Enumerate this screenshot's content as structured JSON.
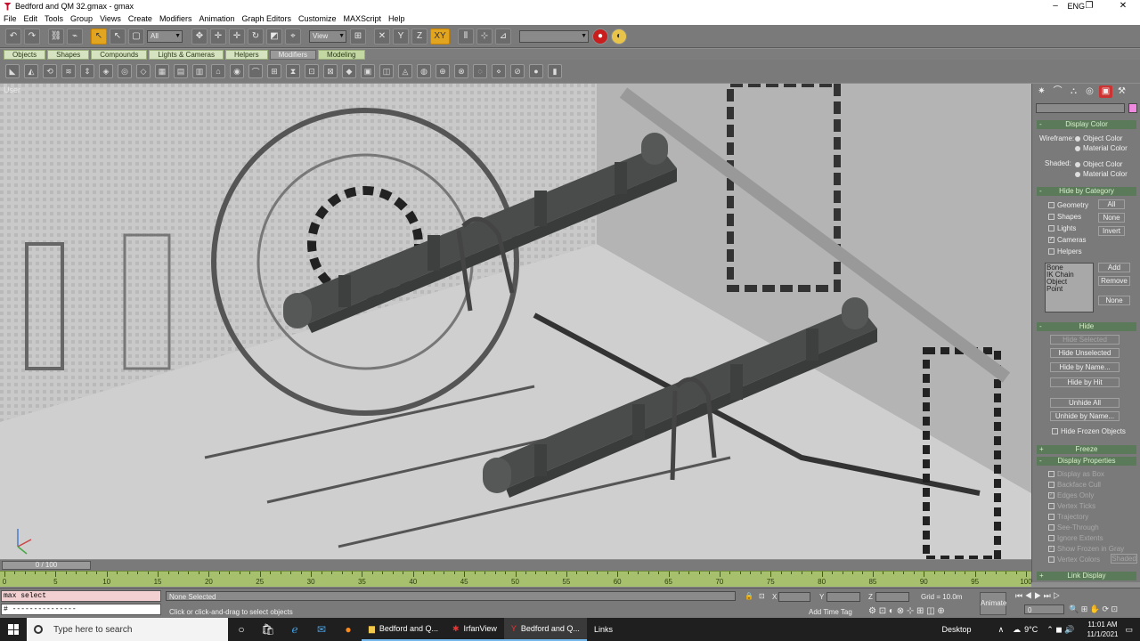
{
  "window": {
    "title": "Bedford and QM 32.gmax - gmax",
    "minimize": "–",
    "maximize": "❐",
    "close": "✕"
  },
  "menu": [
    "File",
    "Edit",
    "Tools",
    "Group",
    "Views",
    "Create",
    "Modifiers",
    "Animation",
    "Graph Editors",
    "Customize",
    "MAXScript",
    "Help"
  ],
  "toolbar": {
    "selection_filter": "All",
    "ref_coord": "View",
    "named_sel": ""
  },
  "tabs": [
    "Objects",
    "Shapes",
    "Compounds",
    "Lights & Cameras",
    "Helpers",
    "Modifiers",
    "Modeling"
  ],
  "viewport": {
    "label": "User"
  },
  "panel": {
    "display_color": {
      "title": "Display Color",
      "wireframe_label": "Wireframe:",
      "shaded_label": "Shaded:",
      "object_color": "Object Color",
      "material_color": "Material Color"
    },
    "hide_by_category": {
      "title": "Hide by Category",
      "items": [
        "Geometry",
        "Shapes",
        "Lights",
        "Cameras",
        "Helpers"
      ],
      "all": "All",
      "none": "None",
      "invert": "Invert",
      "list": [
        "Bone",
        "IK Chain Object",
        "Point"
      ],
      "add": "Add",
      "remove": "Remove",
      "none2": "None"
    },
    "hide": {
      "title": "Hide",
      "buttons": [
        "Hide Selected",
        "Hide Unselected",
        "Hide by Name...",
        "Hide by Hit",
        "Unhide All",
        "Unhide by Name..."
      ],
      "hide_frozen": "Hide Frozen Objects"
    },
    "freeze": {
      "title": "Freeze"
    },
    "display_properties": {
      "title": "Display Properties",
      "items": [
        "Display as Box",
        "Backface Cull",
        "Edges Only",
        "Vertex Ticks",
        "Trajectory",
        "See-Through",
        "Ignore Extents",
        "Show Frozen in Gray",
        "Vertex Colors"
      ],
      "shaded": "Shaded"
    },
    "link_display": {
      "title": "Link Display"
    }
  },
  "timeline": {
    "slider": "0 / 100",
    "ticks": [
      "0",
      "5",
      "10",
      "15",
      "20",
      "25",
      "30",
      "35",
      "40",
      "45",
      "50",
      "55",
      "60",
      "65",
      "70",
      "75",
      "80",
      "85",
      "90",
      "95",
      "100"
    ]
  },
  "status": {
    "maxscript_line1": "max select",
    "maxscript_line2": "# ---------------",
    "selection": "None Selected",
    "prompt": "Click or click-and-drag to select objects",
    "x_label": "X",
    "y_label": "Y",
    "z_label": "Z",
    "grid": "Grid = 10.0m",
    "add_time_tag": "Add Time Tag",
    "animate": "Animate",
    "frame": "0"
  },
  "taskbar": {
    "search_placeholder": "Type here to search",
    "apps": [
      "Bedford and Q...",
      "IrfanView",
      "Bedford and Q...",
      "Links"
    ],
    "desktop": "Desktop",
    "weather": "9°C",
    "lang": "ENG",
    "time": "11:01 AM",
    "date": "11/1/2021"
  }
}
